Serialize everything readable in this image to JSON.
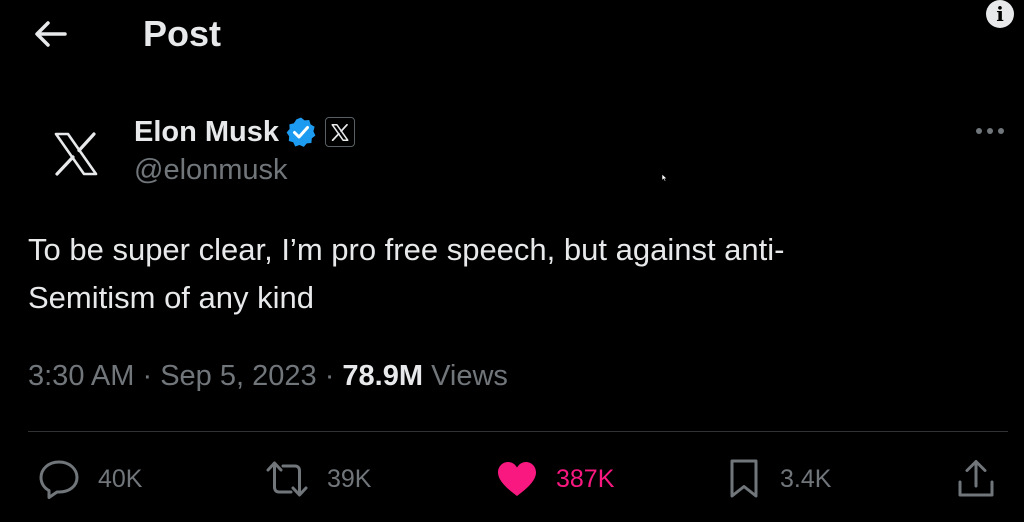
{
  "header": {
    "title": "Post",
    "back_icon": "arrow-left-icon",
    "info_label": "i"
  },
  "author": {
    "avatar_icon": "x-logo-icon",
    "display_name": "Elon Musk",
    "verified_icon": "verified-badge-icon",
    "affiliate_icon": "x-logo-icon",
    "handle": "@elonmusk",
    "more_icon": "more-horizontal-icon"
  },
  "post": {
    "text_line1": "To be super clear, I’m pro free speech, but against anti-",
    "text_line2": "Semitism of any kind",
    "time": "3:30 AM",
    "date": "Sep 5, 2023",
    "separator": "·",
    "views_count": "78.9M",
    "views_label": "Views"
  },
  "actions": {
    "reply": {
      "icon": "reply-icon",
      "count": "40K"
    },
    "repost": {
      "icon": "repost-icon",
      "count": "39K"
    },
    "like": {
      "icon": "heart-icon",
      "count": "387K"
    },
    "bookmark": {
      "icon": "bookmark-icon",
      "count": "3.4K"
    },
    "share": {
      "icon": "share-icon"
    }
  },
  "colors": {
    "background": "#000000",
    "text_primary": "#e7e9ea",
    "text_secondary": "#71767b",
    "verified_blue": "#1d9bf0",
    "like_pink": "#f91880",
    "divider": "#2f3336"
  }
}
